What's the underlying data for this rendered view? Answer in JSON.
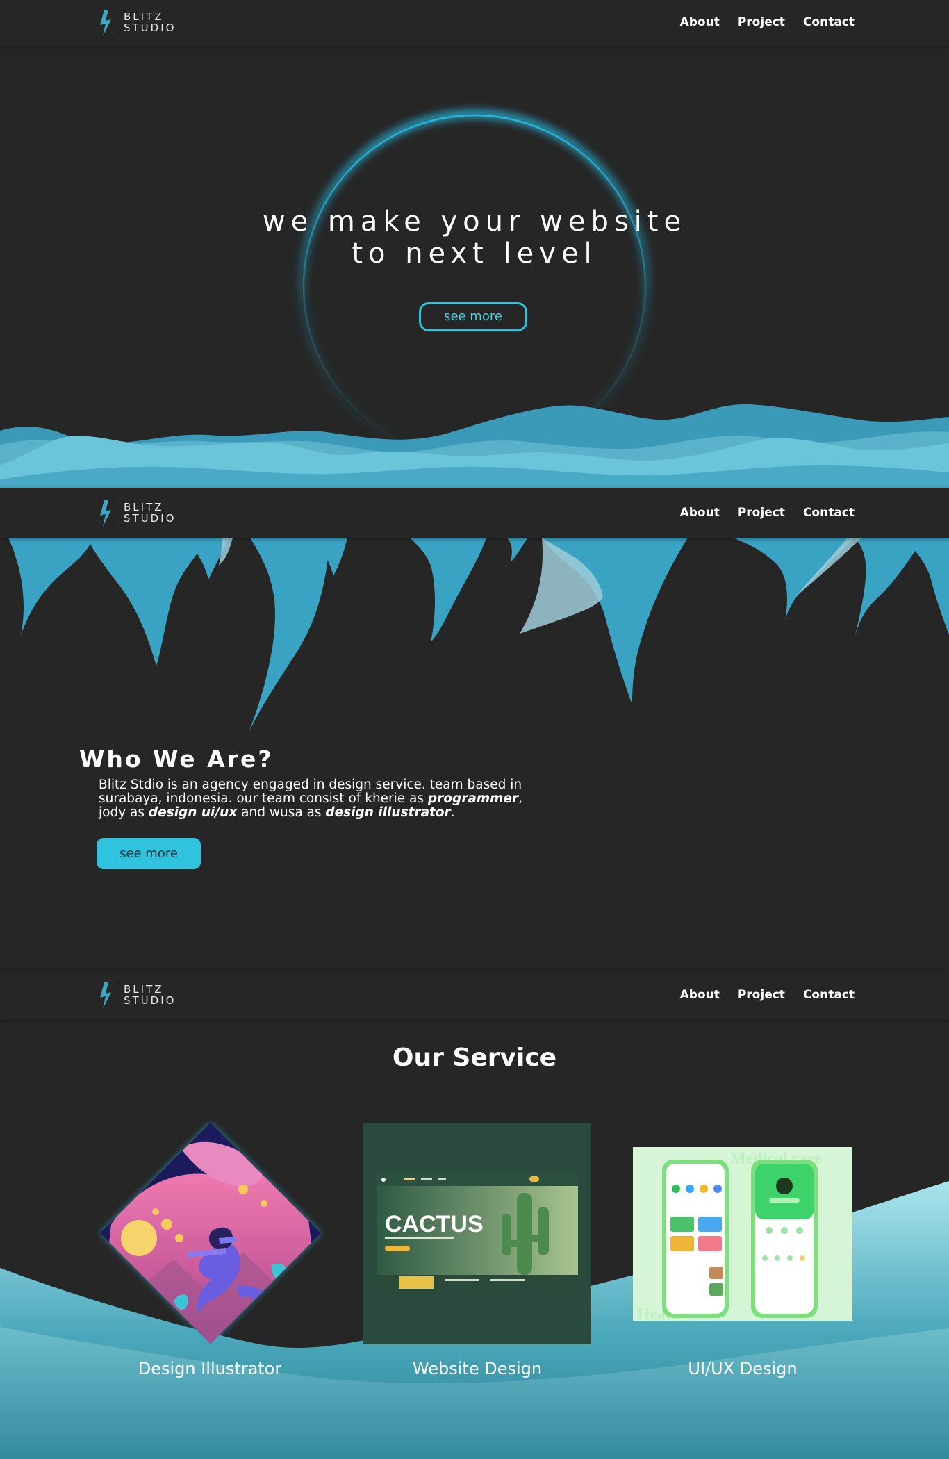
{
  "brand": {
    "line1": "BLITZ",
    "line2": "STUDIO",
    "accent": "#2fc3dd"
  },
  "nav": {
    "about": "About",
    "project": "Project",
    "contact": "Contact"
  },
  "hero": {
    "title_line1": "we make your website",
    "title_line2": "to next level",
    "button": "see more"
  },
  "about": {
    "title": "Who We Are?",
    "text_part1": "Blitz Stdio is an agency engaged in design service. team based in surabaya, indonesia. our team consist of kherie as ",
    "role1": "programmer",
    "text_part2": ", jody as ",
    "role2": "design ui/ux",
    "text_part3": " and wusa as ",
    "role3": "design illustrator",
    "text_part4": ".",
    "button": "see more"
  },
  "services": {
    "title": "Our Service",
    "items": [
      {
        "label": "Design Illustrator"
      },
      {
        "label": "Website Design"
      },
      {
        "label": "UI/UX Design"
      }
    ],
    "mockup_web": {
      "brand": "CACTUS"
    },
    "mockup_app": {
      "bg_text_top": "Medical care",
      "bg_text_bottom": "Health"
    }
  }
}
